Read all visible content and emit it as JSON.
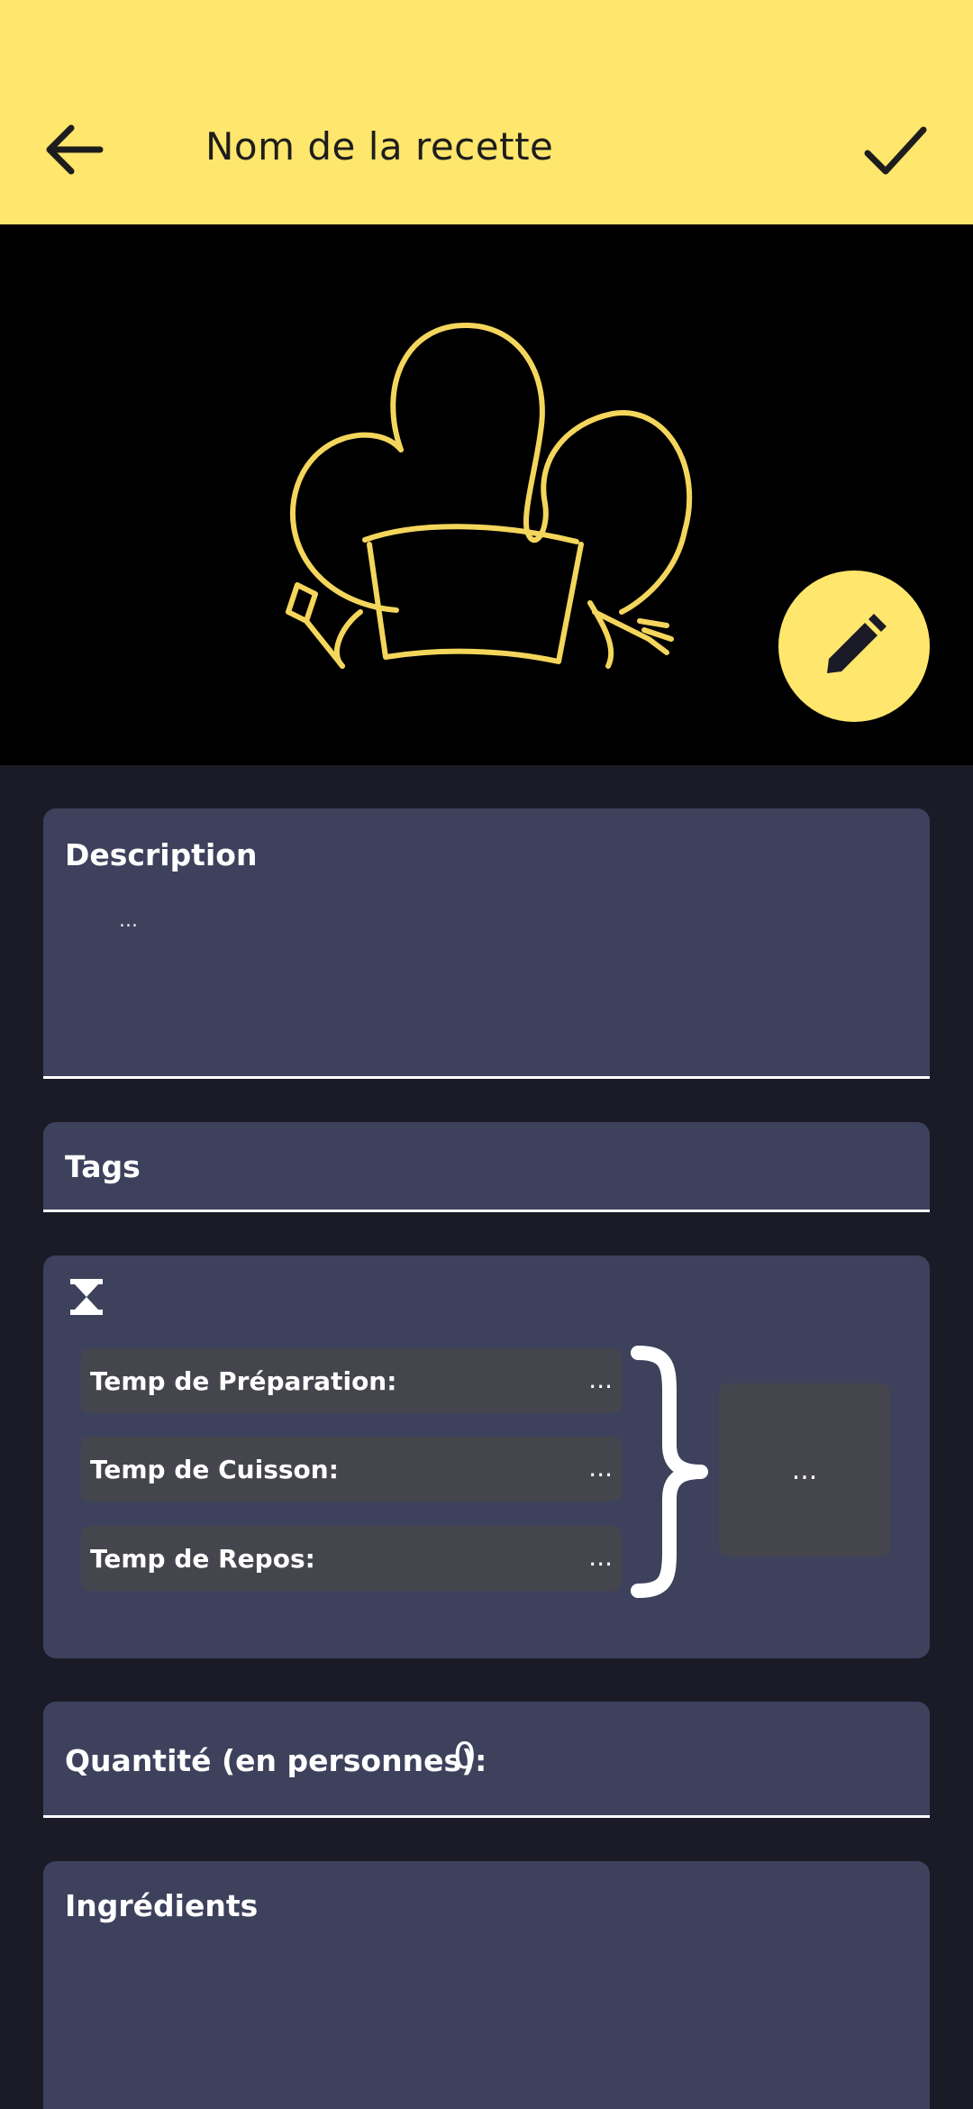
{
  "header": {
    "title": "Nom de la recette",
    "back_icon": "arrow-left-icon",
    "confirm_icon": "check-icon",
    "background": "#ffe66c"
  },
  "hero": {
    "logo_icon": "chef-hat-logo",
    "edit_icon": "pencil-icon",
    "accent": "#ffe66c"
  },
  "description": {
    "label": "Description",
    "value": "..."
  },
  "tags": {
    "label": "Tags"
  },
  "times": {
    "icon": "hourglass-icon",
    "rows": [
      {
        "label": "Temp de Préparation:",
        "value": "..."
      },
      {
        "label": "Temp de Cuisson:",
        "value": "..."
      },
      {
        "label": "Temp de Repos:",
        "value": "..."
      }
    ],
    "total": "..."
  },
  "quantity": {
    "label": "Quantité (en personnes):",
    "value": "0"
  },
  "ingredients": {
    "label": "Ingrédients"
  }
}
